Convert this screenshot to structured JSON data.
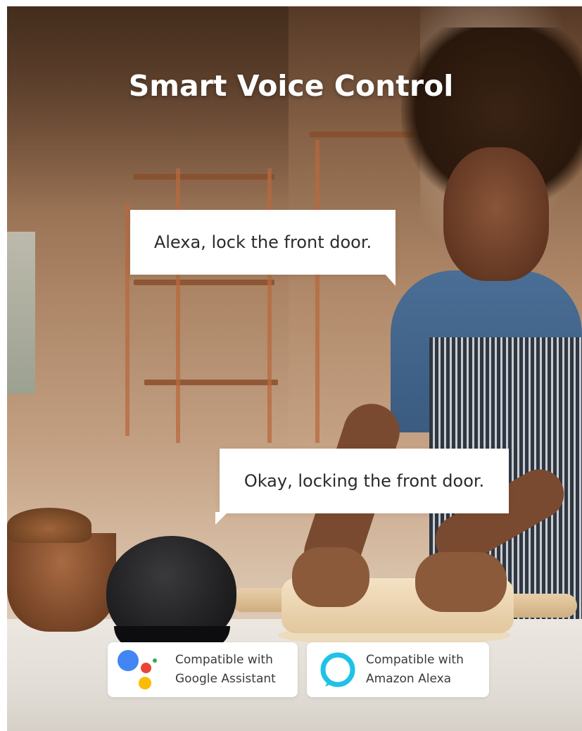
{
  "title": "Smart Voice Control",
  "bubbles": {
    "user": "Alexa, lock the front door.",
    "assistant": "Okay, locking the front door."
  },
  "badges": {
    "google": {
      "line1": "Compatible with",
      "line2": "Google Assistant",
      "icon": "google-assistant-icon"
    },
    "alexa": {
      "line1": "Compatible with",
      "line2": "Amazon Alexa",
      "icon": "alexa-icon"
    }
  },
  "colors": {
    "google_blue": "#4285F4",
    "google_red": "#EA4335",
    "google_yellow": "#FBBC05",
    "google_green": "#34A853",
    "alexa_cyan": "#1FC2E6"
  }
}
